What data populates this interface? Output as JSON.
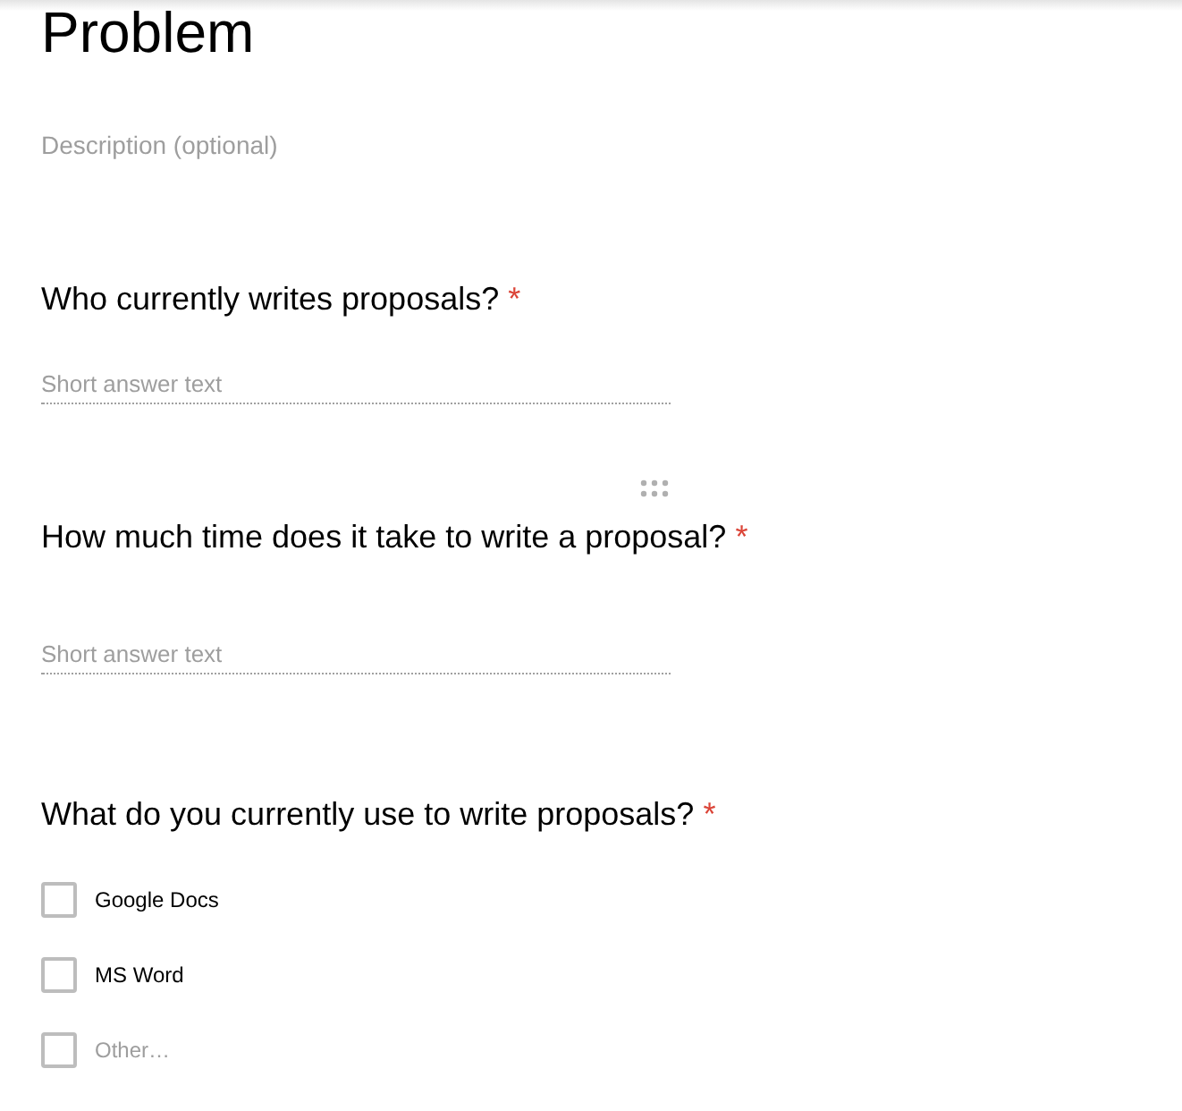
{
  "section": {
    "title": "Problem",
    "description_placeholder": "Description (optional)"
  },
  "questions": [
    {
      "title": "Who currently writes proposals?",
      "required": true,
      "required_mark": "*",
      "drag_handle": false,
      "kind": "short",
      "placeholder": "Short answer text"
    },
    {
      "title": "How much time does it take to write a proposal?",
      "required": true,
      "required_mark": "*",
      "drag_handle": true,
      "kind": "short",
      "placeholder": "Short answer text"
    },
    {
      "title": "What do you currently use to write proposals?",
      "required": true,
      "required_mark": "*",
      "drag_handle": false,
      "kind": "checkboxes",
      "options": [
        {
          "label": "Google Docs",
          "kind": "option",
          "checked": false
        },
        {
          "label": "MS Word",
          "kind": "option",
          "checked": false
        },
        {
          "label": "Other…",
          "kind": "other",
          "checked": false
        }
      ]
    }
  ]
}
